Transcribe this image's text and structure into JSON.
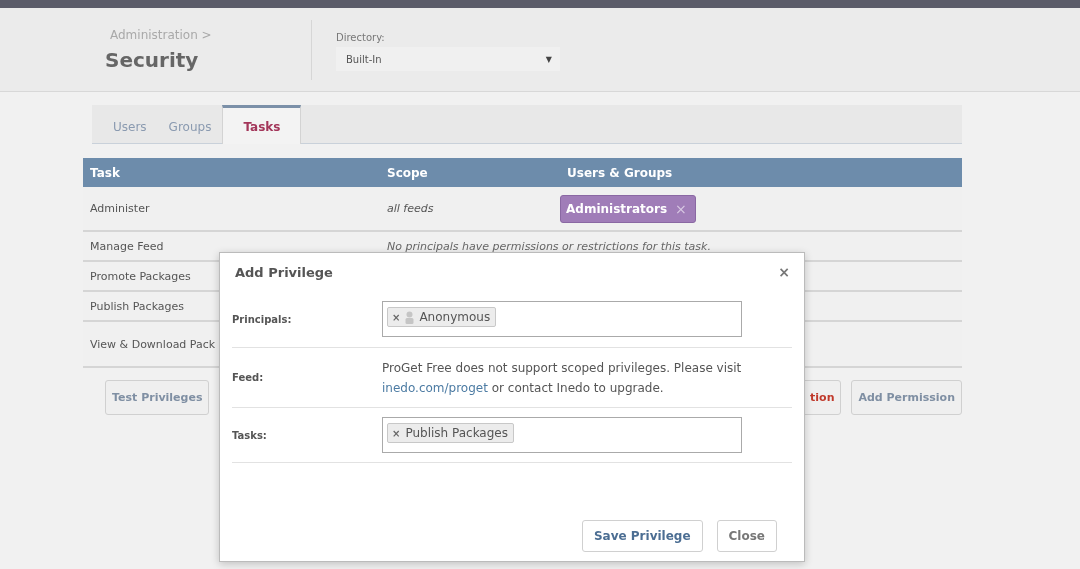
{
  "header": {
    "breadcrumb": "Administration >",
    "title": "Security",
    "directory": {
      "label": "Directory:",
      "value": "Built-In",
      "caret": "▼"
    }
  },
  "tabs": [
    {
      "label": "Users",
      "selected": false
    },
    {
      "label": "Groups",
      "selected": false
    },
    {
      "label": "Tasks",
      "selected": true
    }
  ],
  "table": {
    "columns": [
      "Task",
      "Scope",
      "Users & Groups"
    ],
    "rows": [
      {
        "task": "Administer",
        "scope": "all feeds",
        "principals": [
          {
            "label": "Administrators",
            "remove": "×"
          }
        ]
      },
      {
        "task": "Manage Feed",
        "note": "No principals have permissions or restrictions for this task."
      },
      {
        "task": "Promote Packages"
      },
      {
        "task": "Publish Packages"
      },
      {
        "task": "View & Download Pack"
      }
    ]
  },
  "actions": {
    "left": "Test Privileges",
    "partial": "tion",
    "right": "Add Permission"
  },
  "dialog": {
    "title": "Add Privilege",
    "close": "×",
    "fields": [
      {
        "kind": "tags",
        "label": "Principals:",
        "tags": [
          {
            "label": "Anonymous",
            "remove": "×",
            "user": true
          }
        ]
      },
      {
        "kind": "text",
        "label": "Feed:",
        "text": "ProGet Free does not support scoped privileges. Please visit",
        "link": "inedo.com/proget",
        "after": "or contact Inedo to upgrade."
      },
      {
        "kind": "tags",
        "label": "Tasks:",
        "tags": [
          {
            "label": "Publish Packages",
            "remove": "×",
            "user": false
          }
        ]
      }
    ],
    "buttons": [
      "Save Privilege",
      "Close"
    ]
  }
}
